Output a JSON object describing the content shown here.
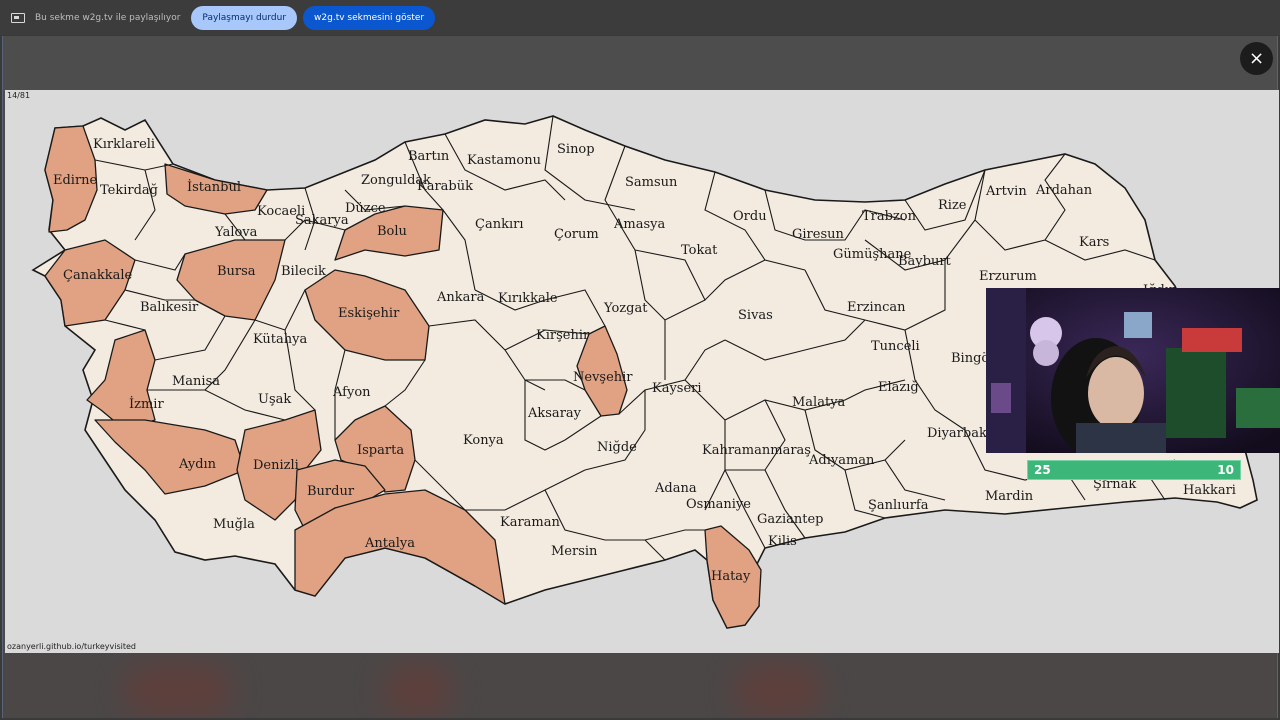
{
  "share_bar": {
    "text": "Bu sekme w2g.tv ile paylaşılıyor",
    "stop_button": "Paylaşmayı durdur",
    "show_button": "w2g.tv sekmesini göster"
  },
  "close_icon": "×",
  "map": {
    "counter": "14/81",
    "source": "ozanyerli.github.io/turkeyvisited",
    "visited_color": "#e0a282",
    "unvisited_color": "#f3ebe0",
    "visited": [
      "Edirne",
      "İstanbul",
      "Çanakkale",
      "Bursa",
      "Bolu",
      "Eskişehir",
      "İzmir",
      "Aydın",
      "Denizli",
      "Isparta",
      "Burdur",
      "Antalya",
      "Nevşehir",
      "Hatay"
    ],
    "labels": {
      "kirklareli": "Kırklareli",
      "edirne": "Edirne",
      "tekirdag": "Tekirdağ",
      "istanbul": "İstanbul",
      "kocaeli": "Kocaeli",
      "yalova": "Yalova",
      "sakarya": "Sakarya",
      "duzce": "Düzce",
      "zonguldak": "Zonguldak",
      "bartin": "Bartın",
      "karabuk": "Karabük",
      "kastamonu": "Kastamonu",
      "sinop": "Sinop",
      "samsun": "Samsun",
      "canakkale": "Çanakkale",
      "bursa": "Bursa",
      "bilecik": "Bilecik",
      "bolu": "Bolu",
      "cankiri": "Çankırı",
      "corum": "Çorum",
      "amasya": "Amasya",
      "ordu": "Ordu",
      "giresun": "Giresun",
      "trabzon": "Trabzon",
      "rize": "Rize",
      "artvin": "Artvin",
      "ardahan": "Ardahan",
      "kars": "Kars",
      "igdir": "Iğdır",
      "gumushane": "Gümüşhane",
      "bayburt": "Bayburt",
      "erzurum": "Erzurum",
      "tokat": "Tokat",
      "balikesir": "Balıkesir",
      "eskisehir": "Eskişehir",
      "ankara": "Ankara",
      "kirikkale": "Kırıkkale",
      "yozgat": "Yozgat",
      "sivas": "Sivas",
      "erzincan": "Erzincan",
      "tunceli": "Tunceli",
      "bingol": "Bingöl",
      "kutahya": "Kütahya",
      "manisa": "Manisa",
      "kirsehir": "Kırşehir",
      "nevsehir": "Nevşehir",
      "kayseri": "Kayseri",
      "malatya": "Malatya",
      "elazig": "Elazığ",
      "izmir": "İzmir",
      "usak": "Uşak",
      "afyon": "Afyon",
      "aksaray": "Aksaray",
      "diyarbakir": "Diyarbakır",
      "konya": "Konya",
      "isparta": "Isparta",
      "nigde": "Niğde",
      "kahramanmaras": "Kahramanmaraş",
      "adiyaman": "Adıyaman",
      "aydin": "Aydın",
      "denizli": "Denizli",
      "burdur": "Burdur",
      "adana": "Adana",
      "osmaniye": "Osmaniye",
      "sirnak": "Şırnak",
      "hakkari": "Hakkari",
      "mardin": "Mardin",
      "sanliurfa": "Şanlıurfa",
      "mugla": "Muğla",
      "karaman": "Karaman",
      "gaziantep": "Gaziantep",
      "kilis": "Kilis",
      "antalya": "Antalya",
      "mersin": "Mersin",
      "hatay": "Hatay"
    }
  },
  "score": {
    "left": "25",
    "right": "10"
  }
}
